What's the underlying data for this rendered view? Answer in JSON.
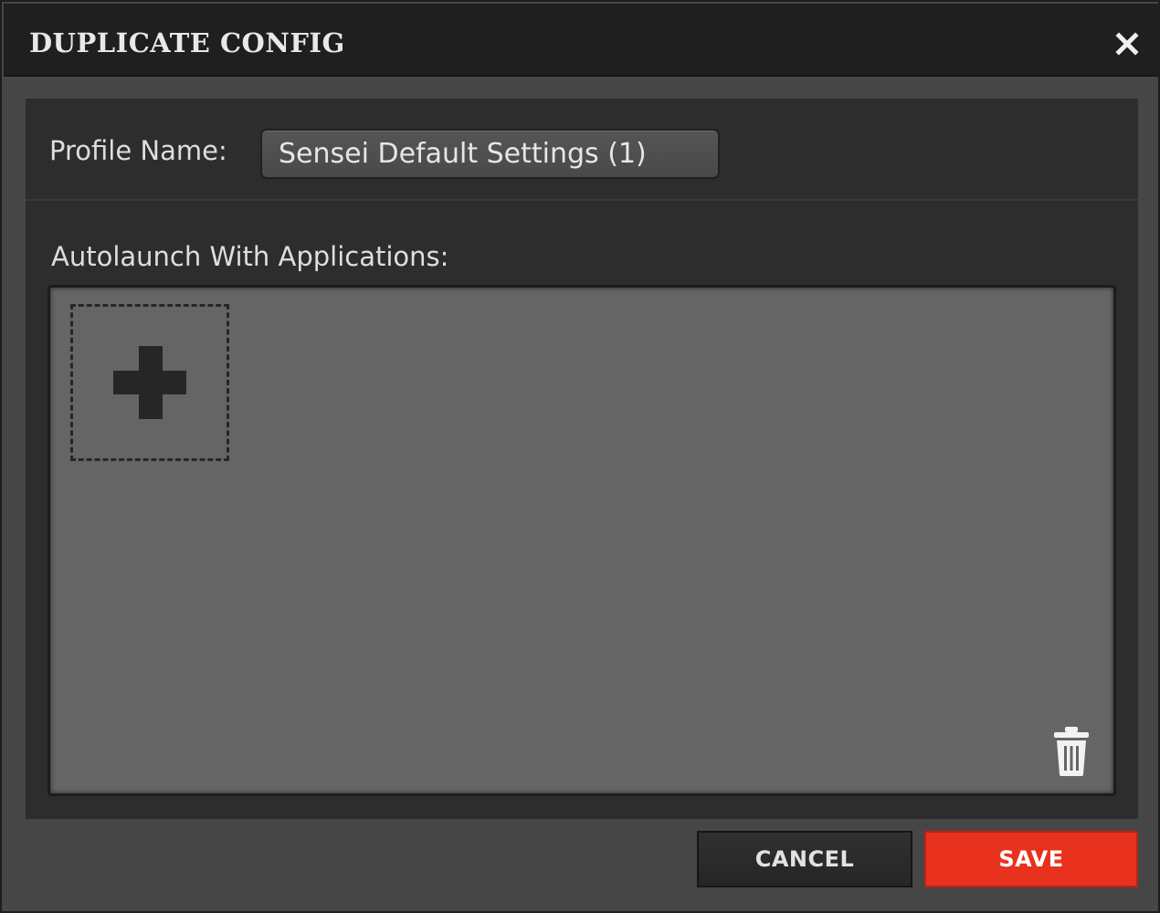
{
  "dialog": {
    "title": "DUPLICATE CONFIG",
    "profile_name_label": "Profile Name:",
    "profile_name_value": "Sensei Default Settings (1)",
    "autolaunch_label": "Autolaunch With Applications:",
    "cancel_label": "CANCEL",
    "save_label": "SAVE"
  },
  "icons": {
    "close": "close-icon",
    "add": "plus-icon",
    "delete": "trash-icon"
  },
  "colors": {
    "save_accent": "#e8321e",
    "titlebar": "#1f1f1f",
    "panel": "#2d2d2d",
    "app_area": "#656565"
  }
}
